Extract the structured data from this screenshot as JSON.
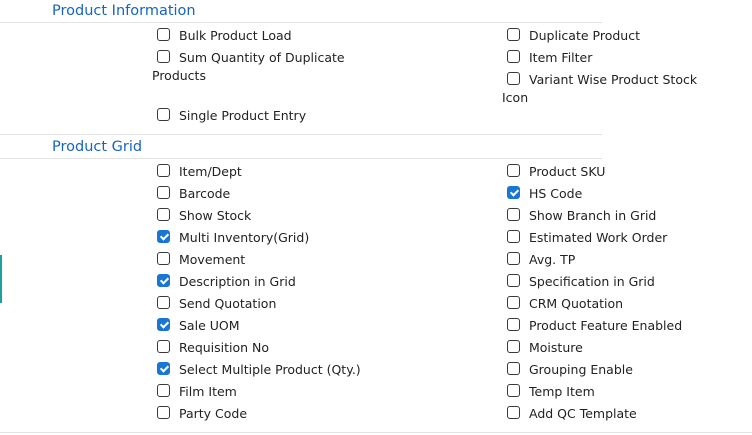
{
  "sections": {
    "product_information": {
      "title": "Product Information",
      "left": [
        {
          "label": "Bulk Product Load",
          "checked": false
        },
        {
          "label": "Sum Quantity of Duplicate",
          "label_cont": "Products",
          "checked": false
        },
        {
          "label": "Single Product Entry",
          "checked": false
        }
      ],
      "right": [
        {
          "label": "Duplicate Product",
          "checked": false
        },
        {
          "label": "Item Filter",
          "checked": false
        },
        {
          "label": "Variant Wise Product Stock",
          "label_cont": "Icon",
          "checked": false
        }
      ]
    },
    "product_grid": {
      "title": "Product Grid",
      "left": [
        {
          "label": "Item/Dept",
          "checked": false
        },
        {
          "label": "Barcode",
          "checked": false
        },
        {
          "label": "Show Stock",
          "checked": false
        },
        {
          "label": "Multi Inventory(Grid)",
          "checked": true
        },
        {
          "label": "Movement",
          "checked": false
        },
        {
          "label": "Description in Grid",
          "checked": true
        },
        {
          "label": "Send Quotation",
          "checked": false
        },
        {
          "label": "Sale UOM",
          "checked": true
        },
        {
          "label": "Requisition No",
          "checked": false
        },
        {
          "label": "Select Multiple Product (Qty.)",
          "checked": true
        },
        {
          "label": "Film Item",
          "checked": false
        },
        {
          "label": "Party Code",
          "checked": false
        }
      ],
      "right": [
        {
          "label": "Product SKU",
          "checked": false
        },
        {
          "label": "HS Code",
          "checked": true
        },
        {
          "label": "Show Branch in Grid",
          "checked": false
        },
        {
          "label": "Estimated Work Order",
          "checked": false
        },
        {
          "label": "Avg. TP",
          "checked": false
        },
        {
          "label": "Specification in Grid",
          "checked": false
        },
        {
          "label": "CRM Quotation",
          "checked": false
        },
        {
          "label": "Product Feature Enabled",
          "checked": false
        },
        {
          "label": "Moisture",
          "checked": false
        },
        {
          "label": "Grouping Enable",
          "checked": false
        },
        {
          "label": "Temp Item",
          "checked": false
        },
        {
          "label": "Add QC Template",
          "checked": false
        }
      ]
    }
  },
  "colors": {
    "accent": "#1565c0",
    "checkbox_checked": "#1976d2",
    "side_marker": "#1aa39a"
  }
}
